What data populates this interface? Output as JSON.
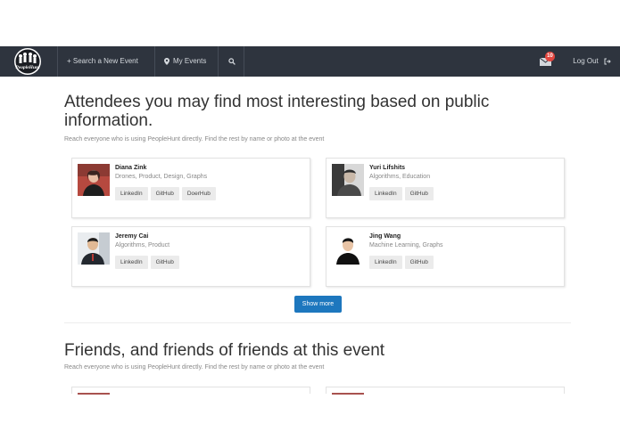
{
  "nav": {
    "logo_text": "PeopleHunt",
    "search_event_label": "+ Search a New Event",
    "my_events_label": "My Events",
    "mail_badge_count": "10",
    "logout_label": "Log Out",
    "icons": {
      "search": "search-icon",
      "mail": "mail-icon",
      "pin": "map-pin-icon",
      "logout": "logout-icon"
    },
    "colors": {
      "bar": "#2e343e",
      "badge": "#e2463f"
    }
  },
  "section1": {
    "heading_line1": "Attendees you may find most interesting based on public",
    "heading_line2": "information.",
    "subtext": "Reach everyone who is using PeopleHunt directly. Find the rest by name or photo at the event"
  },
  "attendees": [
    {
      "name": "Diana Zink",
      "tags": "Drones, Product, Design, Graphs",
      "links": [
        "LinkedIn",
        "GitHub",
        "DoerHub"
      ]
    },
    {
      "name": "Yuri Lifshits",
      "tags": "Algorithms, Education",
      "links": [
        "LinkedIn",
        "GitHub"
      ]
    },
    {
      "name": "Jeremy Cai",
      "tags": "Algorithms, Product",
      "links": [
        "LinkedIn",
        "GitHub"
      ]
    },
    {
      "name": "Jing Wang",
      "tags": "Machine Learning, Graphs",
      "links": [
        "LinkedIn",
        "GitHub"
      ]
    }
  ],
  "show_more_label": "Show more",
  "section2": {
    "heading": "Friends, and friends of friends at this event",
    "subtext": "Reach everyone who is using PeopleHunt directly. Find the rest by name or photo at the event"
  },
  "accent_color": "#1d77be"
}
